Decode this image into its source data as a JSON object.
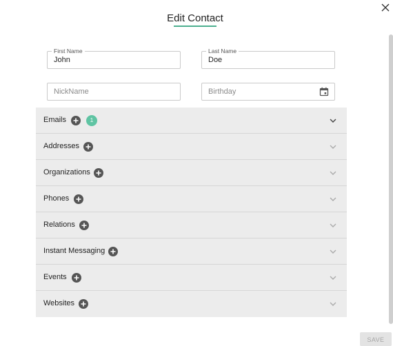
{
  "dialog": {
    "title": "Edit Contact",
    "accent_color": "#4caf8f"
  },
  "fields": {
    "first_name": {
      "label": "First Name",
      "value": "John"
    },
    "last_name": {
      "label": "Last Name",
      "value": "Doe"
    },
    "nickname": {
      "placeholder": "NickName"
    },
    "birthday": {
      "placeholder": "Birthday",
      "icon": "calendar-icon"
    }
  },
  "sections": [
    {
      "label": "Emails",
      "count": "1",
      "expanded_state": "collapsed"
    },
    {
      "label": "Addresses"
    },
    {
      "label": "Organizations"
    },
    {
      "label": "Phones"
    },
    {
      "label": "Relations"
    },
    {
      "label": "Instant Messaging"
    },
    {
      "label": "Events"
    },
    {
      "label": "Websites"
    }
  ],
  "badge_color": "#5fc4a3",
  "footer": {
    "save_label": "SAVE"
  }
}
